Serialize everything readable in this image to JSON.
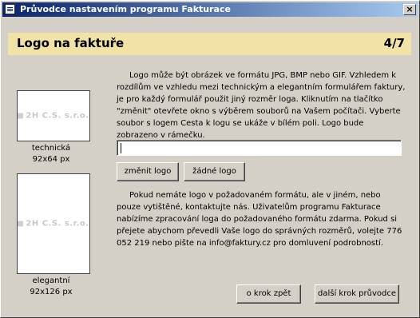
{
  "window": {
    "title": "Průvodce nastavením programu Fakturace",
    "close_label": "×"
  },
  "header": {
    "title": "Logo na faktuře",
    "step": "4/7"
  },
  "logos": [
    {
      "text": "2H C.S. s.r.o.",
      "caption_name": "technická",
      "caption_size": "92x64 px"
    },
    {
      "text": "2H C.S. s.r.o.",
      "caption_name": "elegantní",
      "caption_size": "92x126 px"
    }
  ],
  "paragraph1": "Logo může být obrázek ve formátu JPG, BMP nebo GIF. Vzhledem k rozdílům ve vzhledu mezi technickým a elegantním formulářem faktury, je pro každý formulář použit jiný rozměr loga. Kliknutím na tlačítko \"změnit\" otevřete okno s výběrem souborů na Vašem počítači. Vyberte soubor s logem Cesta k logu se ukáže v bílém poli. Logo bude zobrazeno v rámečku.",
  "logo_path": {
    "value": ""
  },
  "buttons": {
    "change": "změnit logo",
    "none": "žádné logo",
    "back": "o krok zpět",
    "next": "další krok průvodce"
  },
  "paragraph2": "Pokud nemáte logo v požadovaném formátu, ale v jiném, nebo pouze vytištěné, kontaktujte nás. Uživatelům programu Fakturace nabízíme zpracování loga do požadovaného formátu zdarma. Pokud si přejete abychom převedli Vaše logo do správných rozměrů, volejte 776 052 219 nebo pište na info@faktury.cz pro domluvení podrobností."
}
